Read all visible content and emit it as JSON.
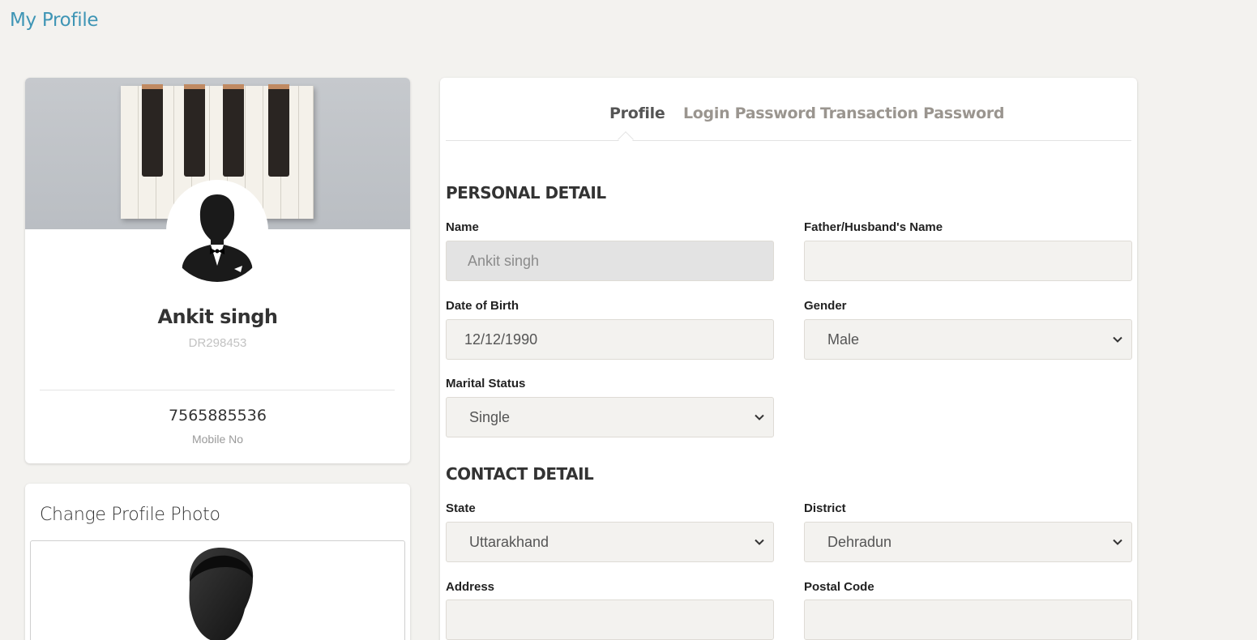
{
  "page": {
    "title": "My Profile"
  },
  "profile_card": {
    "name": "Ankit singh",
    "user_id": "DR298453",
    "mobile": "7565885536",
    "mobile_label": "Mobile No"
  },
  "photo_card": {
    "title": "Change Profile Photo"
  },
  "tabs": [
    {
      "label": "Profile",
      "active": true
    },
    {
      "label": "Login Password",
      "active": false
    },
    {
      "label": "Transaction Password",
      "active": false
    }
  ],
  "personal": {
    "title": "PERSONAL DETAIL",
    "name_label": "Name",
    "name_value": "Ankit singh",
    "father_label": "Father/Husband's Name",
    "father_value": "",
    "dob_label": "Date of Birth",
    "dob_value": "12/12/1990",
    "gender_label": "Gender",
    "gender_value": "Male",
    "marital_label": "Marital Status",
    "marital_value": "Single"
  },
  "contact": {
    "title": "CONTACT DETAIL",
    "state_label": "State",
    "state_value": "Uttarakhand",
    "district_label": "District",
    "district_value": "Dehradun",
    "address_label": "Address",
    "address_value": "",
    "postal_label": "Postal Code",
    "postal_value": ""
  },
  "colors": {
    "accent": "#3e95b5",
    "background": "#f3f2ef"
  },
  "icons": [
    "avatar-silhouette-icon",
    "chevron-down-icon"
  ]
}
